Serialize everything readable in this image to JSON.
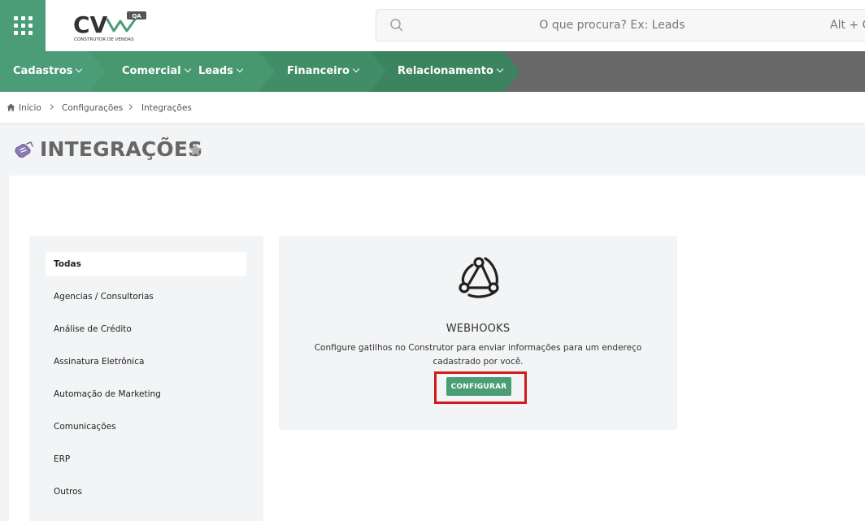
{
  "header": {
    "logo": {
      "brand": "CV",
      "badge": "QA",
      "tagline": "CONSTRUTOR DE VENDAS"
    },
    "search": {
      "placeholder": "O que procura? Ex: Leads",
      "shortcut": "Alt + G"
    }
  },
  "nav": {
    "items": [
      {
        "label": "Cadastros"
      },
      {
        "label": "Comercial"
      },
      {
        "label": "Leads"
      },
      {
        "label": "Financeiro"
      },
      {
        "label": "Relacionamento"
      }
    ],
    "colors": {
      "seg1": "#4a9d77",
      "seg2": "#47976f",
      "seg3": "#418d67",
      "seg4": "#3b845f",
      "rest": "#686868"
    }
  },
  "breadcrumb": {
    "items": [
      "Início",
      "Configurações",
      "Integrações"
    ]
  },
  "page": {
    "title": "INTEGRAÇÕES"
  },
  "sidebar": {
    "categories": [
      {
        "label": "Todas"
      },
      {
        "label": "Agencias / Consultorias"
      },
      {
        "label": "Análise de Crédito"
      },
      {
        "label": "Assinatura Eletrônica"
      },
      {
        "label": "Automação de Marketing"
      },
      {
        "label": "Comunicações"
      },
      {
        "label": "ERP"
      },
      {
        "label": "Outros"
      }
    ]
  },
  "card": {
    "icon": "webhook-icon",
    "title": "WEBHOOKS",
    "description": "Configure gatilhos no Construtor para enviar informações para um endereço cadastrado por você.",
    "button_label": "CONFIGURAR"
  },
  "colors": {
    "accent": "#4a9d77",
    "highlight": "#d11a1a"
  }
}
